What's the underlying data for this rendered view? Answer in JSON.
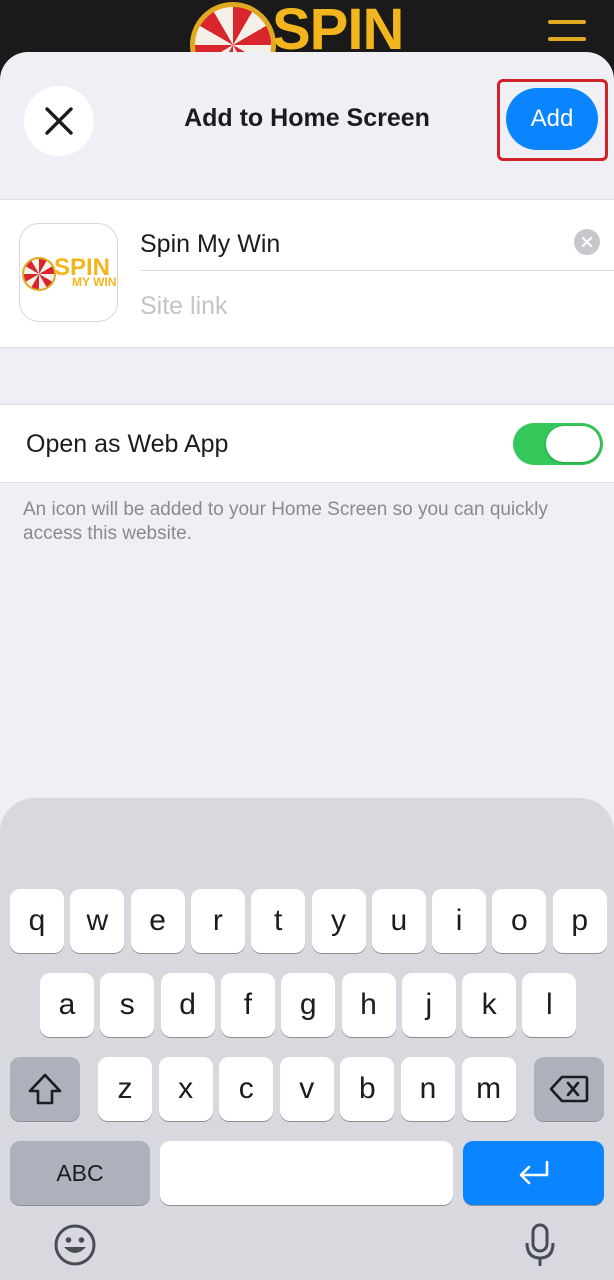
{
  "background_site": {
    "logo_text": "SPIN",
    "menu_icon": "hamburger-menu-icon"
  },
  "sheet": {
    "title": "Add to Home Screen",
    "close_icon": "close-icon",
    "add_label": "Add",
    "accent_color": "#0a84ff",
    "highlight_color": "#d2232a"
  },
  "app": {
    "icon_text_line1": "SPIN",
    "icon_text_line2": "MY WIN",
    "name_value": "Spin My Win",
    "site_link_placeholder": "Site link",
    "clear_icon": "clear-text-icon"
  },
  "web_app": {
    "label": "Open as Web App",
    "enabled": true,
    "toggle_color": "#34c759"
  },
  "footnote": "An icon will be added to your Home Screen so you can quickly access this website.",
  "keyboard": {
    "row1": [
      "q",
      "w",
      "e",
      "r",
      "t",
      "y",
      "u",
      "i",
      "o",
      "p"
    ],
    "row2": [
      "a",
      "s",
      "d",
      "f",
      "g",
      "h",
      "j",
      "k",
      "l"
    ],
    "row3": [
      "z",
      "x",
      "c",
      "v",
      "b",
      "n",
      "m"
    ],
    "shift_icon": "shift-icon",
    "backspace_icon": "backspace-icon",
    "abc_label": "ABC",
    "space_label": "",
    "return_icon": "return-icon",
    "emoji_icon": "emoji-icon",
    "mic_icon": "microphone-icon"
  }
}
